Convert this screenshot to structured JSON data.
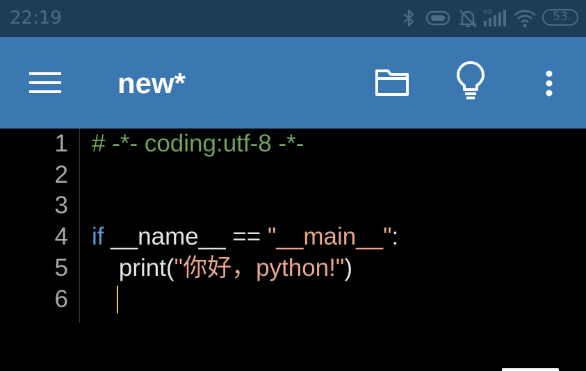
{
  "status_bar": {
    "time": "22:19",
    "battery": "53",
    "icons": [
      "bluetooth-icon",
      "vibrate-icon",
      "alarm-off-icon",
      "hd-signal-icon",
      "wifi-icon",
      "battery-icon"
    ]
  },
  "toolbar": {
    "title": "new*",
    "icons": [
      "menu-icon",
      "folder-icon",
      "lightbulb-icon",
      "more-vert-icon"
    ]
  },
  "editor": {
    "line_numbers": [
      "1",
      "2",
      "3",
      "4",
      "5",
      "6"
    ],
    "lines": [
      [
        {
          "type": "comment",
          "text": "# -*- coding:utf-8 -*-"
        }
      ],
      [],
      [],
      [
        {
          "type": "keyword",
          "text": "if"
        },
        {
          "type": "plain",
          "text": " __name__ == "
        },
        {
          "type": "string",
          "text": "\"__main__\""
        },
        {
          "type": "plain",
          "text": ":"
        }
      ],
      [
        {
          "type": "plain",
          "text": "    print("
        },
        {
          "type": "string",
          "text": "\"你好，python!\""
        },
        {
          "type": "plain",
          "text": ")"
        }
      ],
      []
    ]
  },
  "colors": {
    "status_bar": "#1c3c57",
    "toolbar": "#3b78b2",
    "editor_bg": "#000000",
    "comment": "#72a35a",
    "keyword": "#5a9bd8",
    "string": "#e8a88a",
    "cursor": "#f2d24a"
  }
}
